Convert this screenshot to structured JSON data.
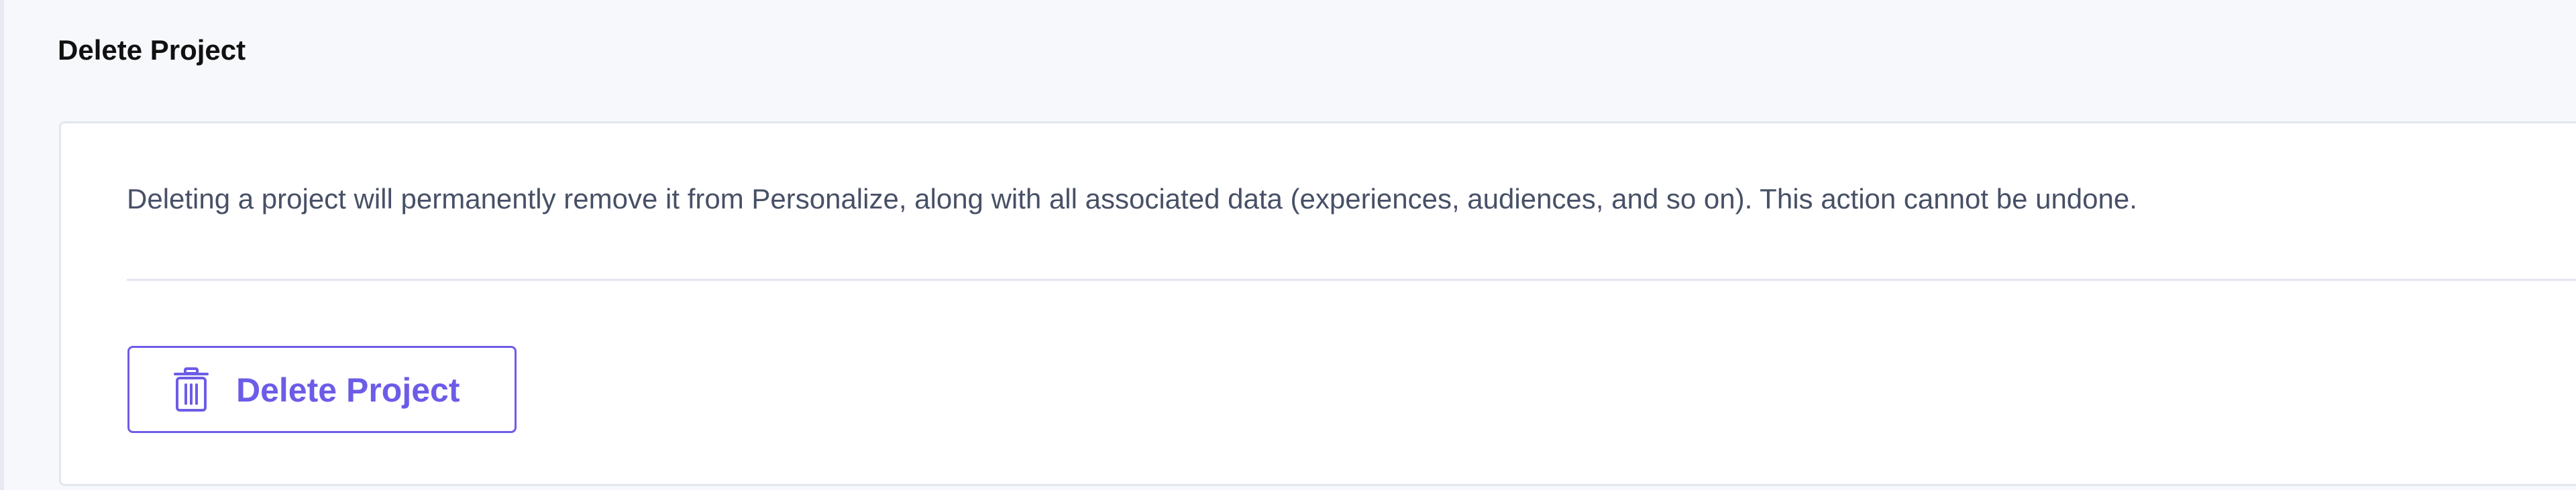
{
  "section": {
    "title": "Delete Project"
  },
  "card": {
    "description": "Deleting a project will permanently remove it from Personalize, along with all associated data (experiences, audiences, and so on). This action cannot be undone.",
    "delete_button": {
      "label": "Delete Project",
      "icon": "trash-icon"
    }
  },
  "colors": {
    "accent": "#6c5ce7",
    "text_primary": "#111111",
    "text_secondary": "#475066",
    "background": "#f7f8fc",
    "border": "#e3e6ef"
  }
}
